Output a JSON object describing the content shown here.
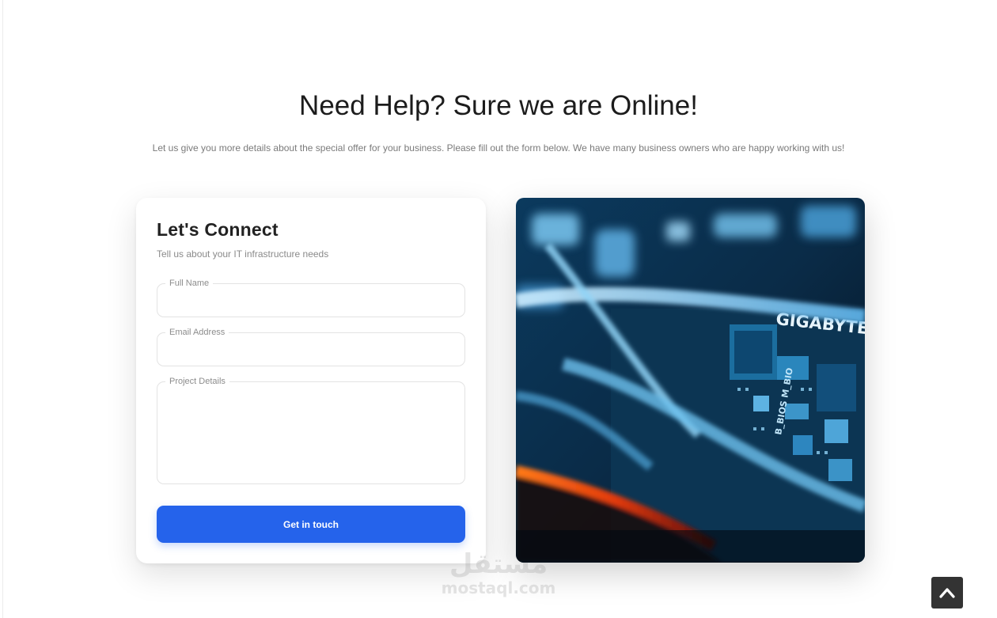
{
  "hero": {
    "title": "Need Help? Sure we are Online!",
    "subtitle": "Let us give you more details about the special offer for your business. Please fill out the form below. We have many business owners who are happy working with us!"
  },
  "form": {
    "title": "Let's Connect",
    "subtitle": "Tell us about your IT infrastructure needs",
    "fields": {
      "full_name": {
        "label": "Full Name",
        "value": ""
      },
      "email": {
        "label": "Email Address",
        "value": ""
      },
      "project": {
        "label": "Project Details",
        "value": ""
      }
    },
    "submit_label": "Get in touch",
    "accent_color": "#2563eb"
  },
  "image": {
    "brand_text": "GIGABYTE",
    "chip_text": "B_BIOS M_BIO",
    "icon": "motherboard-photo"
  },
  "watermark": {
    "arabic": "مستقل",
    "latin": "mostaql.com"
  },
  "scroll_top": {
    "icon": "chevron-up-icon"
  }
}
